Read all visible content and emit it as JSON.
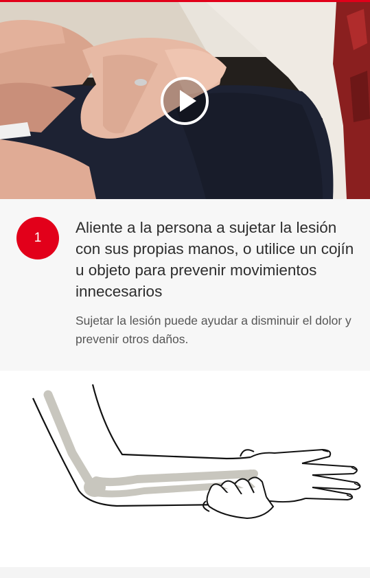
{
  "colors": {
    "accent": "#e2001a",
    "panel_background": "#f7f7f7",
    "bone_color": "#c8c6be"
  },
  "video": {
    "play_icon": "play-icon"
  },
  "step": {
    "number": "1",
    "title": "Aliente a la persona a sujetar la lesión con sus propias manos, o utilice un cojín u objeto para prevenir movimientos innecesarios",
    "description": "Sujetar la lesión puede ayudar a disminuir el dolor y prevenir otros daños."
  }
}
